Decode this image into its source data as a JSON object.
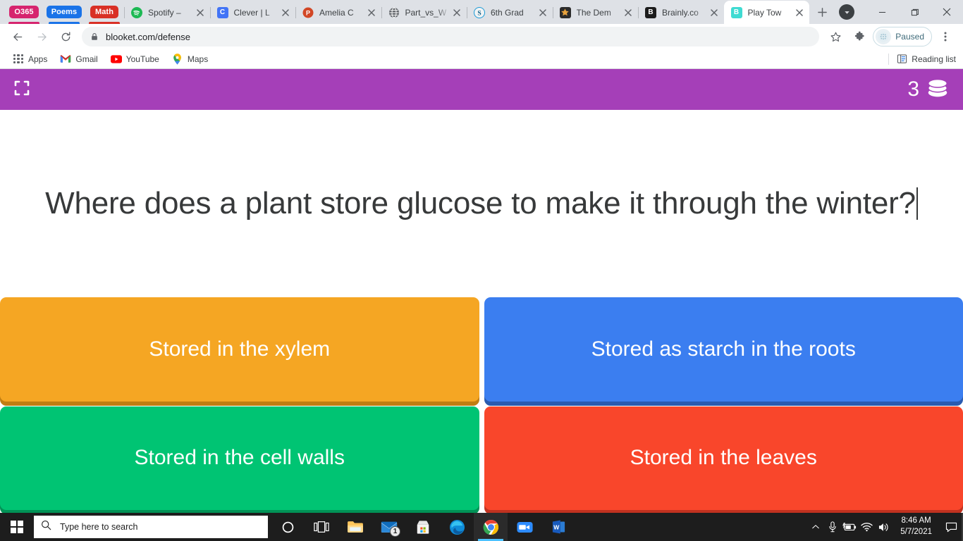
{
  "browser": {
    "pinned_tabs": [
      {
        "label": "O365",
        "color": "#d6246e"
      },
      {
        "label": "Poems",
        "color": "#1a73e8"
      },
      {
        "label": "Math",
        "color": "#d93025"
      }
    ],
    "tabs": [
      {
        "title": "Spotify –",
        "favicon": "spotify-icon",
        "color": "#1db954",
        "active": false
      },
      {
        "title": "Clever | L",
        "favicon": "clever-icon",
        "color": "#4274f6",
        "active": false
      },
      {
        "title": "Amelia C",
        "favicon": "powerpoint-icon",
        "color": "#d24726",
        "active": false
      },
      {
        "title": "Part_vs_W",
        "favicon": "globe-icon",
        "color": "#5f6368",
        "active": false
      },
      {
        "title": "6th Grad",
        "favicon": "seesaw-icon",
        "color": "#1b9ad6",
        "active": false
      },
      {
        "title": "The Dem",
        "favicon": "star-icon",
        "color": "#e8a33d",
        "active": false
      },
      {
        "title": "Brainly.co",
        "favicon": "brainly-icon",
        "color": "#1c1c1c",
        "active": false
      },
      {
        "title": "Play Tow",
        "favicon": "blooket-icon",
        "color": "#3fdbd2",
        "active": true
      }
    ],
    "new_tab_label": "+",
    "window_controls": {
      "minimize": "—",
      "maximize": "▢",
      "close": "✕"
    },
    "toolbar": {
      "back": "back-arrow",
      "forward": "forward-arrow",
      "reload": "reload",
      "url": "blooket.com/defense",
      "bookmark_star": "star",
      "extensions": "puzzle-piece",
      "profile_status": "Paused",
      "menu": "three-dot-menu"
    },
    "bookmarks": [
      {
        "label": "Apps",
        "icon": "apps-grid-icon"
      },
      {
        "label": "Gmail",
        "icon": "gmail-icon"
      },
      {
        "label": "YouTube",
        "icon": "youtube-icon"
      },
      {
        "label": "Maps",
        "icon": "maps-pin-icon"
      }
    ],
    "reading_list": {
      "label": "Reading list",
      "icon": "reading-list-icon"
    }
  },
  "game": {
    "header": {
      "fullscreen_icon": "fullscreen-expand-icon",
      "coin_count": "3",
      "coin_icon": "coin-stack-icon",
      "background_color": "#a53fb8"
    },
    "question": "Where does a plant store glucose to make it through the winter?",
    "answers": [
      {
        "label": "Stored in the xylem",
        "color": "#f5a623",
        "shadow": "#c07d12"
      },
      {
        "label": "Stored as starch in the roots",
        "color": "#3b7ef0",
        "shadow": "#2a5bb0"
      },
      {
        "label": "Stored in the cell walls",
        "color": "#00c473",
        "shadow": "#019256"
      },
      {
        "label": "Stored in the leaves",
        "color": "#f9462b",
        "shadow": "#c03220"
      }
    ]
  },
  "taskbar": {
    "start_icon": "windows-start-icon",
    "search_placeholder": "Type here to search",
    "apps": [
      {
        "name": "cortana-icon",
        "active": false
      },
      {
        "name": "task-view-icon",
        "active": false
      },
      {
        "name": "file-explorer-icon",
        "active": false
      },
      {
        "name": "mail-icon",
        "active": false,
        "badge": "1"
      },
      {
        "name": "microsoft-store-icon",
        "active": false
      },
      {
        "name": "edge-icon",
        "active": false
      },
      {
        "name": "chrome-icon",
        "active": true
      },
      {
        "name": "zoom-icon",
        "active": false
      },
      {
        "name": "word-icon",
        "active": false
      }
    ],
    "tray": [
      "show-hidden-icons-chevron",
      "microphone-icon",
      "battery-charging-icon",
      "wifi-icon",
      "volume-icon"
    ],
    "clock_time": "8:46 AM",
    "clock_date": "5/7/2021",
    "action_center_icon": "action-center-icon"
  }
}
